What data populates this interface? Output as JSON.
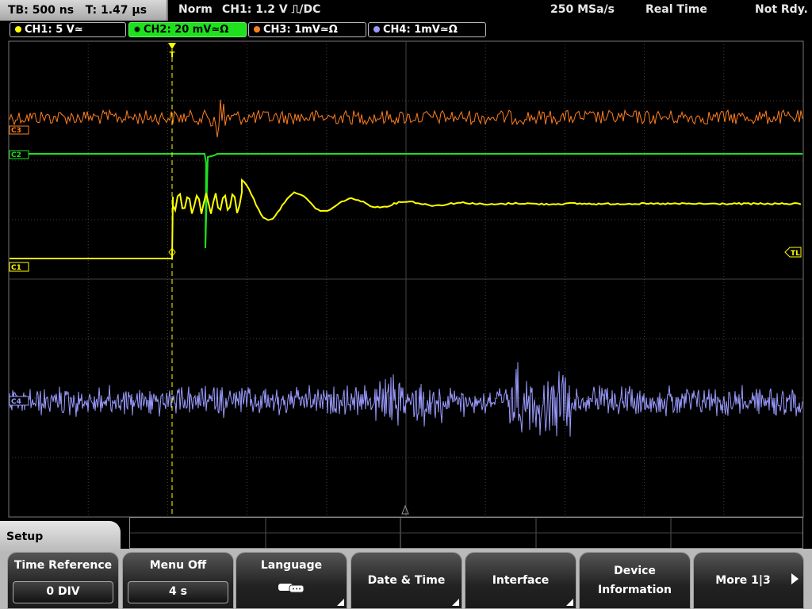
{
  "status": {
    "timebase": "TB: 500 ns",
    "trigger_time": "T: 1.47 µs",
    "mode": "Norm",
    "trigger": "CH1: 1.2 V ⎍/DC",
    "sample_rate": "250 MSa/s",
    "acq_mode": "Real Time",
    "state": "Not Rdy."
  },
  "channels": [
    {
      "label": "CH1: 5 V≃",
      "color": "#ffff00"
    },
    {
      "label": "CH2: 20 mV≃Ω",
      "color": "#1fe01f"
    },
    {
      "label": "CH3: 1mV≃Ω",
      "color": "#ff7f1f"
    },
    {
      "label": "CH4: 1mV≃Ω",
      "color": "#9a9aff"
    }
  ],
  "markers": {
    "c1": "C1",
    "c2": "C2",
    "c3": "C3",
    "c4": "C4",
    "trigger_level": "TL",
    "trigger_pos": "T"
  },
  "menu": {
    "title": "Setup",
    "softkeys": [
      {
        "label": "Time Reference",
        "value": "0 DIV"
      },
      {
        "label": "Menu Off",
        "value": "4 s"
      },
      {
        "label": "Language",
        "icon": "speech-bubble-icon"
      },
      {
        "label": "Date & Time"
      },
      {
        "label": "Interface"
      },
      {
        "label_line1": "Device",
        "label_line2": "Information"
      },
      {
        "label": "More 1|3"
      }
    ]
  },
  "colors": {
    "ch1": "#ffff00",
    "ch2": "#1fe01f",
    "ch3": "#ff7f1f",
    "ch4": "#9a9aff",
    "grid": "#555555"
  }
}
